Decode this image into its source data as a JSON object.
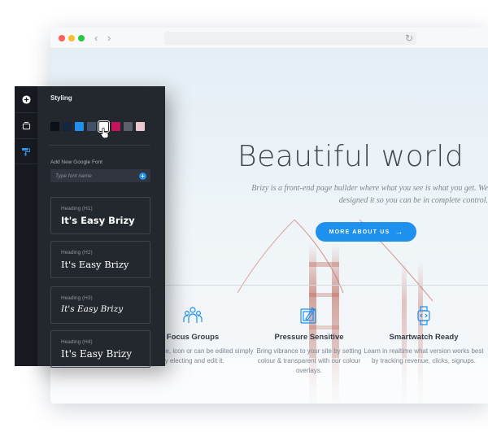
{
  "browser": {
    "nav": {
      "back_icon": "chevron-left-icon",
      "forward_icon": "chevron-right-icon",
      "reload_icon": "reload-icon"
    }
  },
  "hero": {
    "title": "Beautiful world",
    "subtitle": "Brizy is a front-end page builder where what you see is what you get. We designed it so you can be in complete control.",
    "button_label": "MORE ABOUT US",
    "button_arrow": "→"
  },
  "features": [
    {
      "title": "Focus Groups",
      "description": "y text, image, icon or can be edited simply by electing and edit it.",
      "icon": "group-icon"
    },
    {
      "title": "Pressure Sensitive",
      "description": "Bring vibrance to your site by setting colour & transparent with our colour overlays.",
      "icon": "tablet-pen-icon"
    },
    {
      "title": "Smartwatch Ready",
      "description": "Learn in realtime what version works best by tracking revenue, clicks, signups.",
      "icon": "smartwatch-icon"
    }
  ],
  "sidebar": {
    "items": [
      {
        "icon": "plus-circle-icon"
      },
      {
        "icon": "layers-icon"
      },
      {
        "icon": "paint-icon"
      }
    ]
  },
  "panel": {
    "title": "Styling",
    "swatches": [
      "#0c0f17",
      "#16243f",
      "#1e90ee",
      "#43526b",
      "#ffffff",
      "#c4155c",
      "#5a616c",
      "#e9c8cf"
    ],
    "active_swatch_index": 4,
    "font_label": "Add New Google Font",
    "font_placeholder": "Type font name",
    "headings": [
      {
        "label": "Heading (H1)",
        "sample": "It's Easy Brizy"
      },
      {
        "label": "Heading (H2)",
        "sample": "It's Easy Brizy"
      },
      {
        "label": "Heading (H3)",
        "sample": "It's Easy Brizy"
      },
      {
        "label": "Heading (H4)",
        "sample": "It's Easy Brizy"
      }
    ]
  },
  "colors": {
    "accent": "#1e90ee",
    "panel_bg": "#23272e",
    "sidebar_bg": "#181b21"
  }
}
